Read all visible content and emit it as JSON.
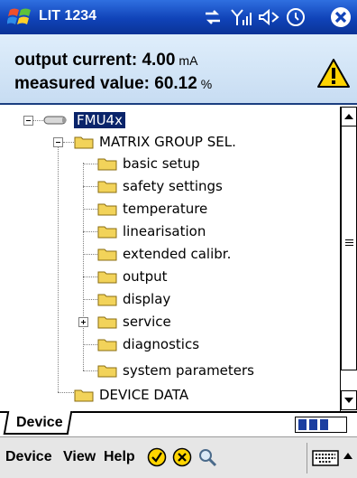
{
  "titlebar": {
    "title": "LIT 1234",
    "icons": [
      "windows-flag-icon",
      "connectivity-icon",
      "signal-icon",
      "volume-icon",
      "clock-icon",
      "close-icon"
    ]
  },
  "status": {
    "current_label": "output current:",
    "current_value": "4.00",
    "current_unit": "mA",
    "measured_label": "measured value:",
    "measured_value": "60.12",
    "measured_unit": "%",
    "warning_icon": "warning-icon"
  },
  "tree": {
    "root": "FMU4x",
    "matrix": "MATRIX GROUP SEL.",
    "items": [
      "basic setup",
      "safety settings",
      "temperature",
      "linearisation",
      "extended calibr.",
      "output",
      "display",
      "service",
      "diagnostics",
      "system parameters"
    ],
    "device_data": "DEVICE DATA"
  },
  "tabs": {
    "active": "Device"
  },
  "menubar": {
    "device": "Device",
    "view": "View",
    "help": "Help"
  },
  "colors": {
    "titlebar": "#1043b8",
    "selection": "#0a246a",
    "status_panel": "#d4e6f8",
    "folder": "#f2d35a",
    "progress": "#1b3ea0"
  }
}
